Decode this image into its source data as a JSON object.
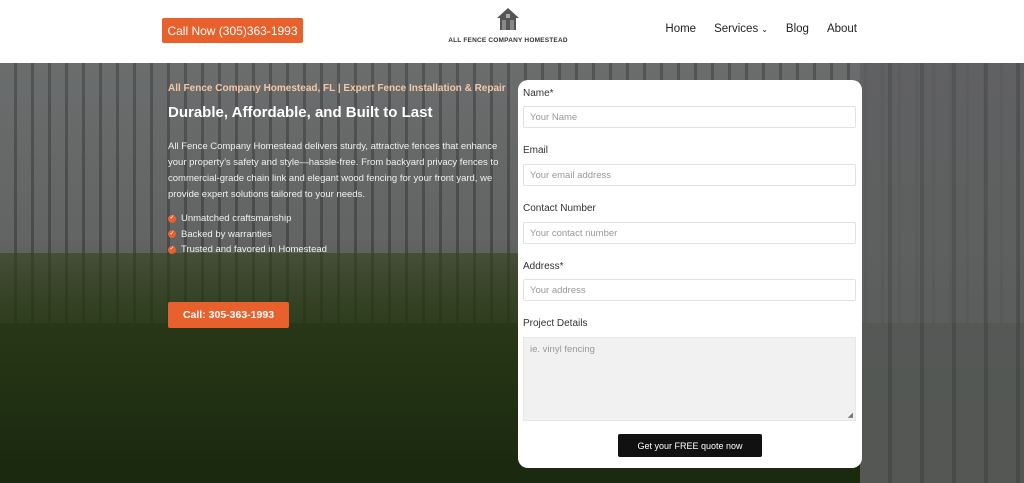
{
  "header": {
    "call_now_label": "Call Now (305)363-1993",
    "logo_text": "ALL FENCE COMPANY HOMESTEAD",
    "nav": [
      {
        "label": "Home"
      },
      {
        "label": "Services"
      },
      {
        "label": "Blog"
      },
      {
        "label": "About"
      }
    ]
  },
  "hero": {
    "tagline": "All Fence Company Homestead, FL | Expert Fence Installation & Repair",
    "headline": "Durable, Affordable, and Built to Last",
    "description": "All Fence Company Homestead delivers sturdy, attractive fences that enhance your property’s safety and style—hassle-free. From backyard privacy fences to commercial-grade chain link and elegant wood fencing for your front yard, we provide expert solutions tailored to your needs.",
    "bullets": [
      "Unmatched craftsmanship",
      "Backed by warranties",
      "Trusted and favored in Homestead"
    ],
    "call_button": "Call: 305-363-1993"
  },
  "form": {
    "name_label": "Name*",
    "name_placeholder": "Your Name",
    "email_label": "Email",
    "email_placeholder": "Your email address",
    "contact_label": "Contact Number",
    "contact_placeholder": "Your contact number",
    "address_label": "Address*",
    "address_placeholder": "Your address",
    "details_label": "Project Details",
    "details_placeholder": "ie. vinyl fencing",
    "submit_label": "Get your FREE quote now"
  },
  "colors": {
    "accent": "#e8612c",
    "submit_bg": "#111111"
  }
}
